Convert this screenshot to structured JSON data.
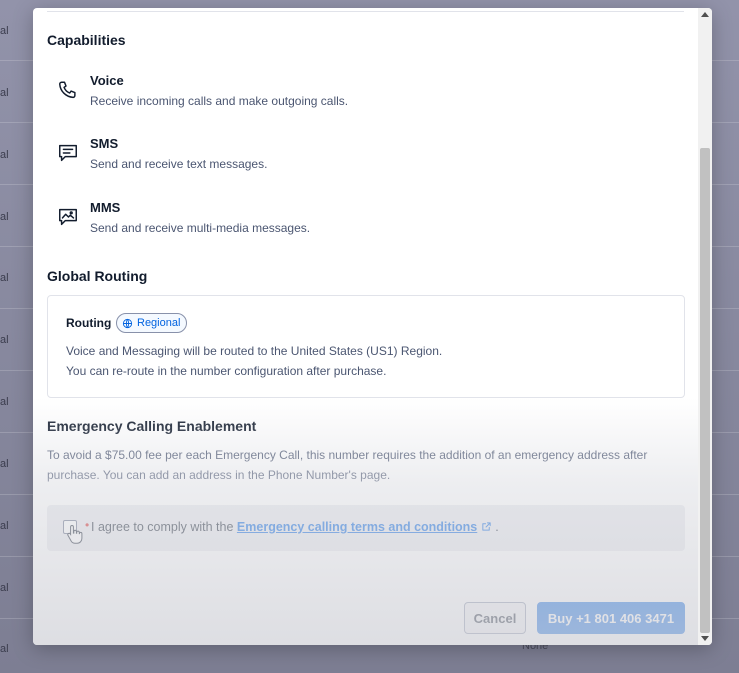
{
  "background": {
    "row_fragment": "al",
    "bottom_fragment": "None"
  },
  "capabilities": {
    "title": "Capabilities",
    "items": [
      {
        "name": "Voice",
        "description": "Receive incoming calls and make outgoing calls.",
        "icon": "phone-icon"
      },
      {
        "name": "SMS",
        "description": "Send and receive text messages.",
        "icon": "message-icon"
      },
      {
        "name": "MMS",
        "description": "Send and receive multi-media messages.",
        "icon": "image-message-icon"
      }
    ]
  },
  "global_routing": {
    "title": "Global Routing",
    "label": "Routing",
    "badge": "Regional",
    "line1": "Voice and Messaging will be routed to the United States (US1) Region.",
    "line2": "You can re-route in the number configuration after purchase."
  },
  "emergency": {
    "title": "Emergency Calling Enablement",
    "line1": "To avoid a $75.00 fee per each Emergency Call, this number requires the addition of an emergency address after",
    "line2": "purchase. You can add an address in the Phone Number's page.",
    "agree_prefix": "I agree to comply with the",
    "agree_link": "Emergency calling terms and conditions",
    "agree_suffix": "."
  },
  "footer": {
    "cancel_label": "Cancel",
    "buy_label": "Buy +1 801 406 3471"
  },
  "colors": {
    "primary": "#0263e0",
    "required": "#d61f1f",
    "text": "#121c2d",
    "muted": "#4b5671"
  }
}
